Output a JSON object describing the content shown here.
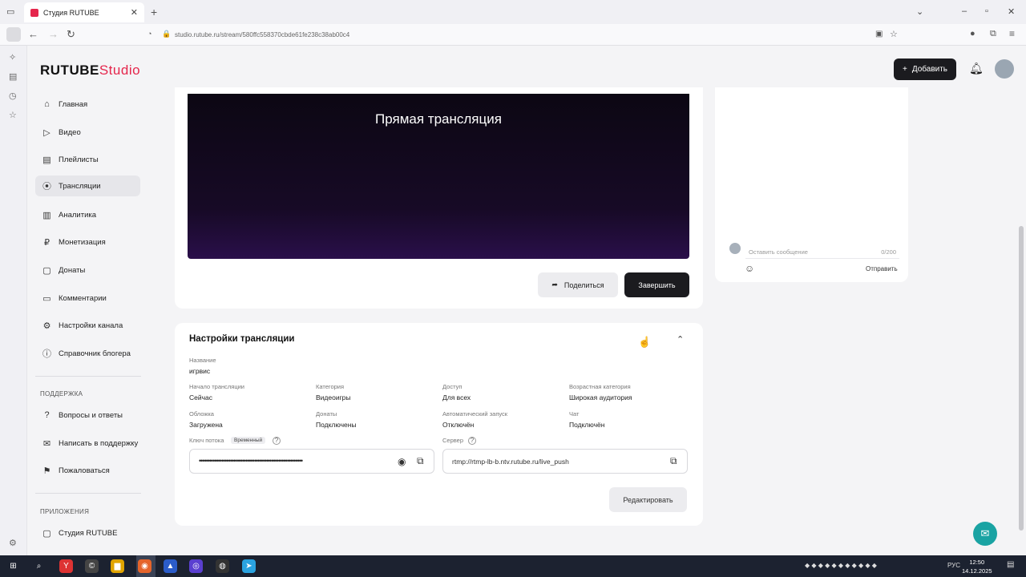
{
  "browser": {
    "tab_title": "Студия RUTUBE",
    "url": "studio.rutube.ru/stream/580ffc558370cbde61fe238c38ab00c4"
  },
  "header": {
    "logo_main": "RUTUBE",
    "logo_sub": "Studio",
    "add_label": "Добавить"
  },
  "sidebar": {
    "items": [
      {
        "label": "Главная",
        "icon": "home-icon"
      },
      {
        "label": "Видео",
        "icon": "video-icon"
      },
      {
        "label": "Плейлисты",
        "icon": "playlist-icon"
      },
      {
        "label": "Трансляции",
        "icon": "broadcast-icon"
      },
      {
        "label": "Аналитика",
        "icon": "analytics-icon"
      },
      {
        "label": "Монетизация",
        "icon": "money-icon"
      },
      {
        "label": "Донаты",
        "icon": "donate-icon"
      },
      {
        "label": "Комментарии",
        "icon": "comment-icon"
      },
      {
        "label": "Настройки канала",
        "icon": "gear-icon"
      },
      {
        "label": "Справочник блогера",
        "icon": "info-icon"
      }
    ],
    "support_heading": "ПОДДЕРЖКА",
    "support_items": [
      {
        "label": "Вопросы и ответы",
        "icon": "question-icon"
      },
      {
        "label": "Написать в поддержку",
        "icon": "mail-icon"
      },
      {
        "label": "Пожаловаться",
        "icon": "flag-icon"
      }
    ],
    "apps_heading": "ПРИЛОЖЕНИЯ",
    "apps_items": [
      {
        "label": "Студия RUTUBE",
        "icon": "studio-icon"
      }
    ]
  },
  "player": {
    "title": "Прямая трансляция",
    "share_label": "Поделиться",
    "finish_label": "Завершить"
  },
  "chat": {
    "placeholder": "Оставить сообщение",
    "counter": "0/200",
    "send_label": "Отправить"
  },
  "settings": {
    "title": "Настройки трансляции",
    "name_label": "Название",
    "name_value": "игрвис",
    "fields": [
      {
        "label": "Начало трансляции",
        "value": "Сейчас"
      },
      {
        "label": "Категория",
        "value": "Видеоигры"
      },
      {
        "label": "Доступ",
        "value": "Для всех"
      },
      {
        "label": "Возрастная категория",
        "value": "Широкая аудитория"
      },
      {
        "label": "Обложка",
        "value": "Загружена"
      },
      {
        "label": "Донаты",
        "value": "Подключены"
      },
      {
        "label": "Автоматический запуск",
        "value": "Отключён"
      },
      {
        "label": "Чат",
        "value": "Подключён"
      }
    ],
    "key_label": "Ключ потока",
    "key_badge": "Временный",
    "key_value": "••••••••••••••••••••••••••••••••••••••••••••••••••••••••••••",
    "server_label": "Сервер",
    "server_value": "rtmp://rtmp-lb-b.ntv.rutube.ru/live_push",
    "edit_label": "Редактировать"
  },
  "taskbar": {
    "lang": "РУС",
    "time": "12:50",
    "date": "14.12.2025"
  }
}
